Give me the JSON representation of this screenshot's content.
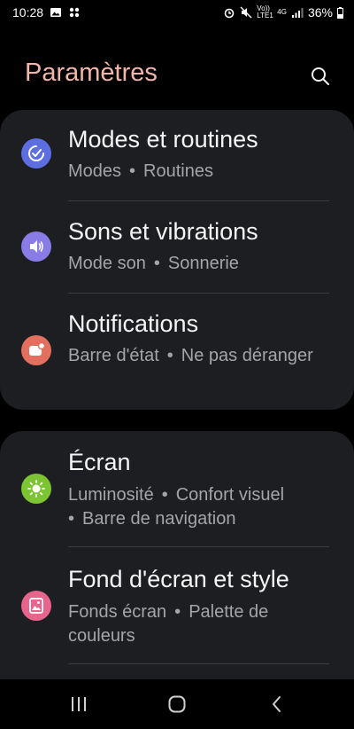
{
  "status_bar": {
    "time": "10:28",
    "volte_label": "Vo)) LTE1",
    "network_label": "4G",
    "battery_percent": "36%"
  },
  "header": {
    "title": "Paramètres"
  },
  "colors": {
    "title_accent": "#f1b6a8",
    "card_bg": "#1c1e21",
    "modes_icon": "#5d6fe0",
    "sounds_icon": "#8a7ce6",
    "notifications_icon": "#e36f5f",
    "display_icon": "#7cc432",
    "wallpaper_icon": "#e7648d"
  },
  "settings": [
    {
      "title": "Modes et routines",
      "subtitle_parts": [
        "Modes",
        "Routines"
      ],
      "icon": "check-circle-icon"
    },
    {
      "title": "Sons et vibrations",
      "subtitle_parts": [
        "Mode son",
        "Sonnerie"
      ],
      "icon": "speaker-icon"
    },
    {
      "title": "Notifications",
      "subtitle_parts": [
        "Barre d'état",
        "Ne pas déranger"
      ],
      "icon": "notification-badge-icon"
    },
    {
      "title": "Écran",
      "subtitle_parts": [
        "Luminosité",
        "Confort visuel",
        "Barre de navigation"
      ],
      "icon": "sun-icon"
    },
    {
      "title": "Fond d'écran et style",
      "subtitle_parts": [
        "Fonds écran",
        "Palette de couleurs"
      ],
      "icon": "wallpaper-icon"
    }
  ],
  "nav_bar": {
    "recents": "recents-icon",
    "home": "home-icon",
    "back": "back-icon"
  }
}
